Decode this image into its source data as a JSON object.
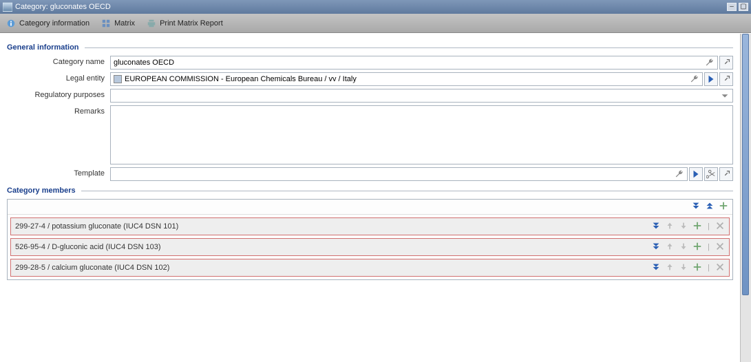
{
  "window_title": "Category: gluconates OECD",
  "toolbar": {
    "category_info": "Category information",
    "matrix": "Matrix",
    "print_report": "Print Matrix Report"
  },
  "sections": {
    "general_info": "General information",
    "category_members": "Category members"
  },
  "fields": {
    "category_name": {
      "label": "Category name",
      "value": "gluconates OECD"
    },
    "legal_entity": {
      "label": "Legal entity",
      "value": "EUROPEAN COMMISSION - European Chemicals Bureau / vv / Italy"
    },
    "regulatory": {
      "label": "Regulatory purposes",
      "value": ""
    },
    "remarks": {
      "label": "Remarks",
      "value": ""
    },
    "template": {
      "label": "Template",
      "value": ""
    }
  },
  "members": [
    {
      "text": "299-27-4 / potassium gluconate (IUC4 DSN 101)"
    },
    {
      "text": "526-95-4 / D-gluconic acid (IUC4 DSN 103)"
    },
    {
      "text": "299-28-5 / calcium gluconate (IUC4 DSN 102)"
    }
  ]
}
